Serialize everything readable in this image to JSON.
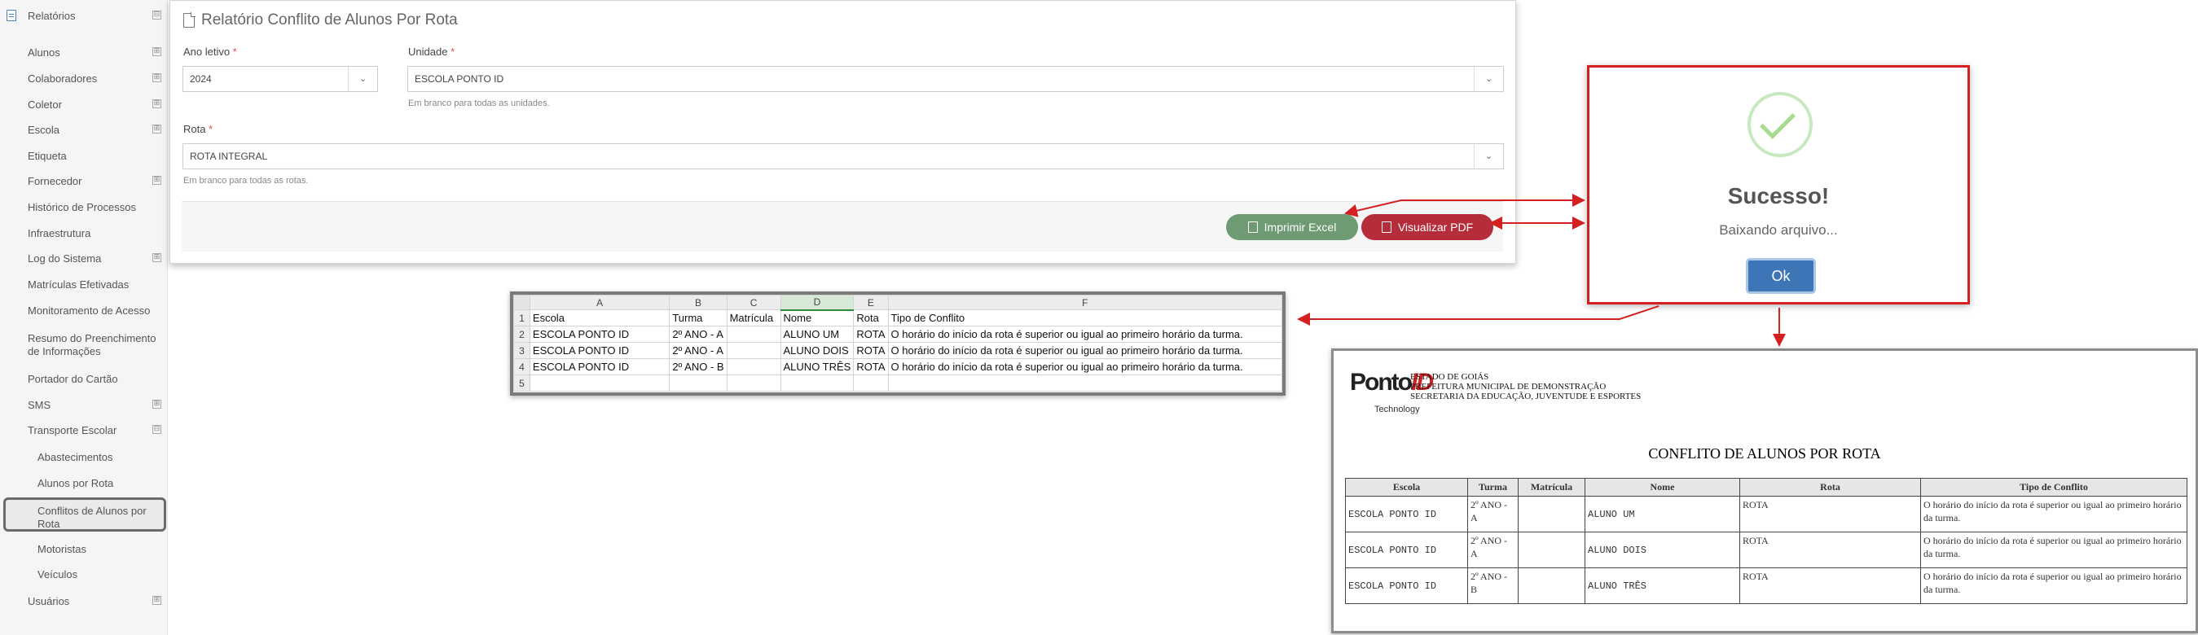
{
  "sidebar": {
    "items": [
      {
        "label": "Relatórios",
        "has_toggle": true,
        "toggle": "⊟"
      },
      {
        "label": "Alunos",
        "has_toggle": true,
        "toggle": "⊞"
      },
      {
        "label": "Colaboradores",
        "has_toggle": true,
        "toggle": "⊞"
      },
      {
        "label": "Coletor",
        "has_toggle": true,
        "toggle": "⊞"
      },
      {
        "label": "Escola",
        "has_toggle": true,
        "toggle": "⊞"
      },
      {
        "label": "Etiqueta",
        "has_toggle": false
      },
      {
        "label": "Fornecedor",
        "has_toggle": true,
        "toggle": "⊞"
      },
      {
        "label": "Histórico de Processos",
        "has_toggle": false
      },
      {
        "label": "Infraestrutura",
        "has_toggle": false
      },
      {
        "label": "Log do Sistema",
        "has_toggle": true,
        "toggle": "⊞"
      },
      {
        "label": "Matrículas Efetivadas",
        "has_toggle": false
      },
      {
        "label": "Monitoramento de Acesso",
        "has_toggle": false
      },
      {
        "label": "Resumo do Preenchimento",
        "label2": "de Informações",
        "has_toggle": false
      },
      {
        "label": "Portador do Cartão",
        "has_toggle": false
      },
      {
        "label": "SMS",
        "has_toggle": true,
        "toggle": "⊞"
      },
      {
        "label": "Transporte Escolar",
        "has_toggle": true,
        "toggle": "⊟"
      },
      {
        "label": "Abastecimentos",
        "sub": true
      },
      {
        "label": "Alunos por Rota",
        "sub": true
      },
      {
        "label": "Conflitos de Alunos por",
        "label2": "Rota",
        "sub": true,
        "active": true
      },
      {
        "label": "Motoristas",
        "sub": true
      },
      {
        "label": "Veículos",
        "sub": true
      },
      {
        "label": "Usuários",
        "has_toggle": true,
        "toggle": "⊞"
      }
    ]
  },
  "form": {
    "title": "Relatório Conflito de Alunos Por Rota",
    "ano_label": "Ano letivo",
    "ano_value": "2024",
    "unidade_label": "Unidade",
    "unidade_value": "ESCOLA PONTO ID",
    "unidade_hint": "Em branco para todas as unidades.",
    "rota_label": "Rota",
    "rota_value": "ROTA INTEGRAL",
    "rota_hint": "Em branco para todas as rotas.",
    "required_mark": "*",
    "caret": "⌄",
    "btn_excel": "Imprimir Excel",
    "btn_pdf": "Visualizar PDF"
  },
  "sheet": {
    "columns": [
      "A",
      "B",
      "C",
      "D",
      "E",
      "F"
    ],
    "selected_column": "D",
    "rows": [
      {
        "n": "1",
        "cells": [
          "Escola",
          "Turma",
          "Matrícula",
          "Nome",
          "Rota",
          "Tipo de Conflito"
        ]
      },
      {
        "n": "2",
        "cells": [
          "ESCOLA PONTO ID",
          "2º ANO - A",
          "",
          "ALUNO UM",
          "ROTA",
          "O horário do início da rota é superior ou igual ao primeiro horário da turma."
        ]
      },
      {
        "n": "3",
        "cells": [
          "ESCOLA PONTO ID",
          "2º ANO - A",
          "",
          "ALUNO DOIS",
          "ROTA",
          "O horário do início da rota é superior ou igual ao primeiro horário da turma."
        ]
      },
      {
        "n": "4",
        "cells": [
          "ESCOLA PONTO ID",
          "2º ANO - B",
          "",
          "ALUNO TRÊS",
          "ROTA",
          "O horário do início da rota é superior ou igual ao primeiro horário da turma."
        ]
      },
      {
        "n": "5",
        "cells": [
          "",
          "",
          "",
          "",
          "",
          ""
        ]
      }
    ]
  },
  "modal": {
    "title": "Sucesso!",
    "text": "Baixando arquivo...",
    "ok": "Ok",
    "check_color": "#a6dc8c"
  },
  "report": {
    "logo_ponto": "Ponto",
    "logo_id": "ID",
    "logo_tech": "Technology",
    "header_lines": [
      "ESTADO DE GOIÁS",
      "PREFEITURA MUNICIPAL DE DEMONSTRAÇÃO",
      "SECRETARIA DA EDUCAÇÃO, JUVENTUDE E ESPORTES"
    ],
    "title": "CONFLITO DE ALUNOS POR ROTA",
    "columns": [
      "Escola",
      "Turma",
      "Matrícula",
      "Nome",
      "Rota",
      "Tipo de Conflito"
    ],
    "rows": [
      [
        "ESCOLA PONTO ID",
        "2º ANO - A",
        "",
        "ALUNO UM",
        "ROTA",
        "O horário do início da rota é superior ou igual ao primeiro horário da turma."
      ],
      [
        "ESCOLA PONTO ID",
        "2º ANO - A",
        "",
        "ALUNO DOIS",
        "ROTA",
        "O horário do início da rota é superior ou igual ao primeiro horário da turma."
      ],
      [
        "ESCOLA PONTO ID",
        "2º ANO - B",
        "",
        "ALUNO TRÊS",
        "ROTA",
        "O horário do início da rota é superior ou igual ao primeiro horário da turma."
      ]
    ]
  },
  "colors": {
    "annotation": "#d42020",
    "excel_button": "#6e9b73",
    "pdf_button": "#b52c3a",
    "ok_button": "#3e75b6"
  }
}
